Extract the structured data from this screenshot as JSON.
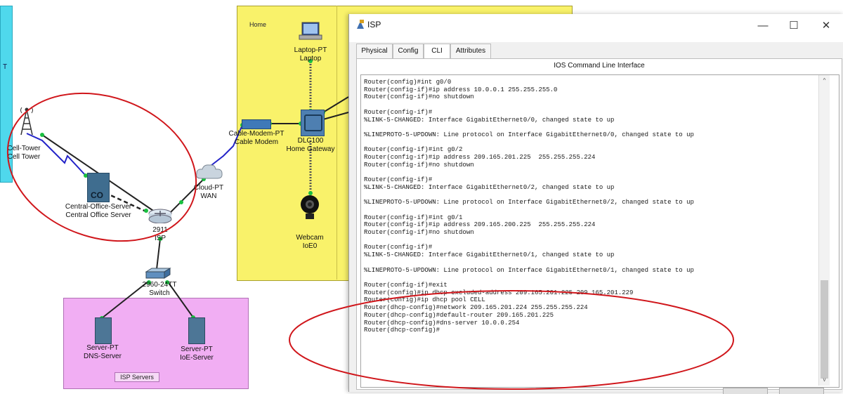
{
  "topology": {
    "left_panel_letter": "T",
    "areas": {
      "home_label": "Home",
      "isp_servers_label": "ISP Servers"
    },
    "devices": {
      "laptop": {
        "model": "Laptop-PT",
        "name": "Laptop"
      },
      "cell_tower": {
        "model": "Cell-Tower",
        "name": "Cell Tower"
      },
      "co_server": {
        "model": "Central-Office-Server",
        "name": "Central Office Server",
        "icon_text": "CO"
      },
      "cable_modem": {
        "model": "Cable-Modem-PT",
        "name": "Cable Modem"
      },
      "home_gateway": {
        "model": "DLC100",
        "name": "Home Gateway"
      },
      "cloud": {
        "model": "Cloud-PT",
        "name": "WAN"
      },
      "router": {
        "model": "2911",
        "name": "ISP"
      },
      "webcam": {
        "model": "Webcam",
        "name": "IoE0"
      },
      "switch": {
        "model": "2960-24TT",
        "name": "Switch"
      },
      "dns_server": {
        "model": "Server-PT",
        "name": "DNS-Server"
      },
      "ioe_server": {
        "model": "Server-PT",
        "name": "IoE-Server"
      }
    }
  },
  "isp_window": {
    "title": "ISP",
    "minimize_glyph": "—",
    "maximize_glyph": "☐",
    "close_glyph": "✕",
    "tabs": [
      {
        "label": "Physical",
        "active": false
      },
      {
        "label": "Config",
        "active": false
      },
      {
        "label": "CLI",
        "active": true
      },
      {
        "label": "Attributes",
        "active": false
      }
    ],
    "cli_header": "IOS Command Line Interface",
    "cli_lines": [
      "Router(config)#int g0/0",
      "Router(config-if)#ip address 10.0.0.1 255.255.255.0",
      "Router(config-if)#no shutdown",
      "",
      "Router(config-if)#",
      "%LINK-5-CHANGED: Interface GigabitEthernet0/0, changed state to up",
      "",
      "%LINEPROTO-5-UPDOWN: Line protocol on Interface GigabitEthernet0/0, changed state to up",
      "",
      "Router(config-if)#int g0/2",
      "Router(config-if)#ip address 209.165.201.225  255.255.255.224",
      "Router(config-if)#no shutdown",
      "",
      "Router(config-if)#",
      "%LINK-5-CHANGED: Interface GigabitEthernet0/2, changed state to up",
      "",
      "%LINEPROTO-5-UPDOWN: Line protocol on Interface GigabitEthernet0/2, changed state to up",
      "",
      "Router(config-if)#int g0/1",
      "Router(config-if)#ip address 209.165.200.225  255.255.255.224",
      "Router(config-if)#no shutdown",
      "",
      "Router(config-if)#",
      "%LINK-5-CHANGED: Interface GigabitEthernet0/1, changed state to up",
      "",
      "%LINEPROTO-5-UPDOWN: Line protocol on Interface GigabitEthernet0/1, changed state to up",
      "",
      "Router(config-if)#exit",
      "Router(config)#ip dhcp excluded-address 209.165.201.225 209.165.201.229",
      "Router(config)#ip dhcp pool CELL",
      "Router(dhcp-config)#network 209.165.201.224 255.255.255.224",
      "Router(dhcp-config)#default-router 209.165.201.225",
      "Router(dhcp-config)#dns-server 10.0.0.254",
      "Router(dhcp-config)#"
    ],
    "scroll_up_glyph": "^",
    "scroll_down_glyph": "v"
  },
  "colors": {
    "annotation": "#d0161b",
    "home_area": "#f9f26a",
    "servers_area": "#f1aef3",
    "link_green": "#19c040",
    "serial_link": "#2323c8"
  }
}
